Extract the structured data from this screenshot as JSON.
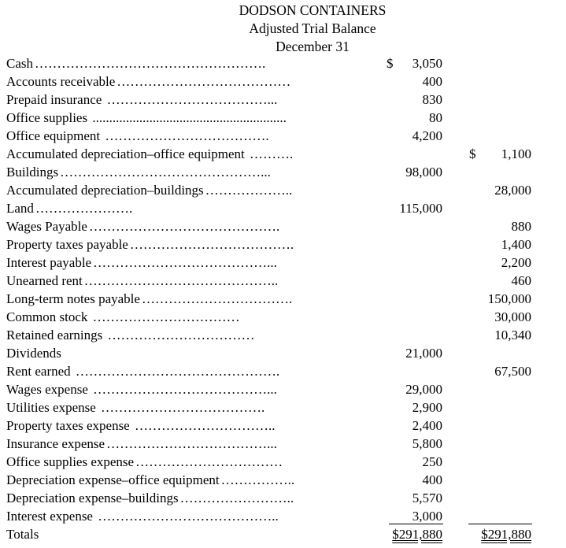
{
  "header": {
    "company": "DODSON CONTAINERS",
    "title": "Adjusted Trial Balance",
    "date": "December 31"
  },
  "rows": [
    {
      "account": "Cash",
      "leader": "…………………………………………….",
      "debit_sign": "$",
      "debit": "3,050",
      "credit_sign": "",
      "credit": ""
    },
    {
      "account": "Accounts receivable",
      "leader": "…………………………………",
      "debit_sign": "",
      "debit": "400",
      "credit_sign": "",
      "credit": ""
    },
    {
      "account": "Prepaid insurance",
      "leader": " ………………………………...",
      "debit_sign": "",
      "debit": "830",
      "credit_sign": "",
      "credit": ""
    },
    {
      "account": "Office supplies",
      "leader": " ..........................................................",
      "debit_sign": "",
      "debit": "80",
      "credit_sign": "",
      "credit": ""
    },
    {
      "account": "Office equipment",
      "leader": " ……………………………….",
      "debit_sign": "",
      "debit": "4,200",
      "credit_sign": "",
      "credit": ""
    },
    {
      "account": "Accumulated depreciation–office equipment",
      "leader": " ……….",
      "debit_sign": "",
      "debit": "",
      "credit_sign": "$",
      "credit": "1,100"
    },
    {
      "account": "Buildings",
      "leader": "………………………………………...",
      "debit_sign": "",
      "debit": "98,000",
      "credit_sign": "",
      "credit": ""
    },
    {
      "account": "Accumulated depreciation–buildings",
      "leader": "………………..",
      "debit_sign": "",
      "debit": "",
      "credit_sign": "",
      "credit": "28,000"
    },
    {
      "account": "Land",
      "leader": "………………….",
      "debit_sign": "",
      "debit": "115,000",
      "credit_sign": "",
      "credit": ""
    },
    {
      "account": "Wages Payable",
      "leader": "…………………………………….",
      "debit_sign": "",
      "debit": "",
      "credit_sign": "",
      "credit": "880"
    },
    {
      "account": "Property taxes payable",
      "leader": "……………………………….",
      "debit_sign": "",
      "debit": "",
      "credit_sign": "",
      "credit": "1,400"
    },
    {
      "account": "Interest payable",
      "leader": "…………………………………...",
      "debit_sign": "",
      "debit": "",
      "credit_sign": "",
      "credit": "2,200"
    },
    {
      "account": "Unearned rent",
      "leader": "……………………………………..",
      "debit_sign": "",
      "debit": "",
      "credit_sign": "",
      "credit": "460"
    },
    {
      "account": "Long-term notes payable",
      "leader": "…………………………….",
      "debit_sign": "",
      "debit": "",
      "credit_sign": "",
      "credit": "150,000"
    },
    {
      "account": "Common stock",
      "leader": " ……………………………",
      "debit_sign": "",
      "debit": "",
      "credit_sign": "",
      "credit": "30,000"
    },
    {
      "account": "Retained earnings",
      "leader": " ……………………………",
      "debit_sign": "",
      "debit": "",
      "credit_sign": "",
      "credit": "10,340"
    },
    {
      "account": "Dividends",
      "leader": "",
      "debit_sign": "",
      "debit": "21,000",
      "credit_sign": "",
      "credit": ""
    },
    {
      "account": "Rent earned",
      "leader": " ……………………………………….",
      "debit_sign": "",
      "debit": "",
      "credit_sign": "",
      "credit": "67,500"
    },
    {
      "account": "Wages expense",
      "leader": " …………………………………...",
      "debit_sign": "",
      "debit": "29,000",
      "credit_sign": "",
      "credit": ""
    },
    {
      "account": "Utilities expense",
      "leader": " ……………………………….",
      "debit_sign": "",
      "debit": "2,900",
      "credit_sign": "",
      "credit": ""
    },
    {
      "account": "Property taxes expense",
      "leader": " …………………………..",
      "debit_sign": "",
      "debit": "2,400",
      "credit_sign": "",
      "credit": ""
    },
    {
      "account": "Insurance expense",
      "leader": "………………………………...",
      "debit_sign": "",
      "debit": "5,800",
      "credit_sign": "",
      "credit": ""
    },
    {
      "account": "Office supplies expense",
      "leader": "……………………………",
      "debit_sign": "",
      "debit": "250",
      "credit_sign": "",
      "credit": ""
    },
    {
      "account": "Depreciation expense–office equipment",
      "leader": "……………..",
      "debit_sign": "",
      "debit": "400",
      "credit_sign": "",
      "credit": ""
    },
    {
      "account": "Depreciation expense–buildings",
      "leader": "……………………..",
      "debit_sign": "",
      "debit": "5,570",
      "credit_sign": "",
      "credit": ""
    },
    {
      "account": "Interest expense",
      "leader": " …………………………………..",
      "debit_sign": "",
      "debit": "3,000",
      "credit_sign": "",
      "credit": ""
    }
  ],
  "totals": {
    "label": "Totals",
    "debit": "$291,880",
    "credit": "$291,880"
  }
}
